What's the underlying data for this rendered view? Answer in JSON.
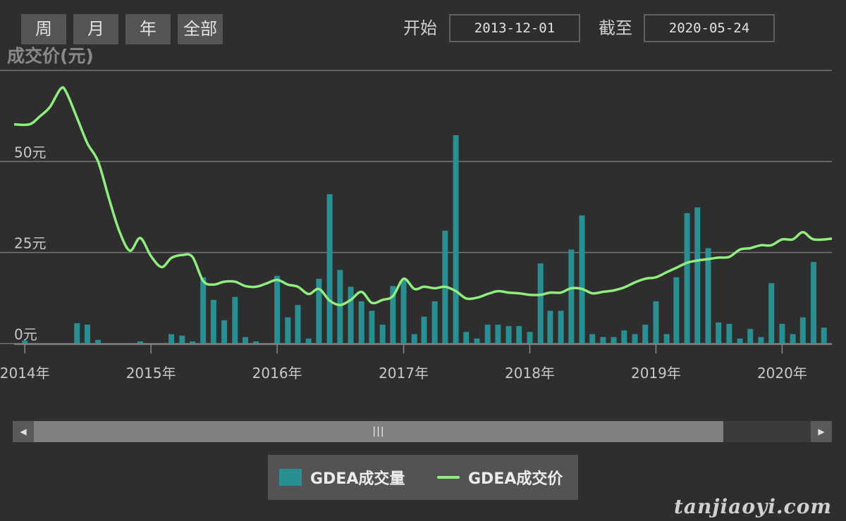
{
  "toolbar": {
    "range_buttons": [
      "周",
      "月",
      "年",
      "全部"
    ],
    "start_label": "开始",
    "start_value": "2013-12-01",
    "end_label": "截至",
    "end_value": "2020-05-24"
  },
  "legend": {
    "volume_label": "GDEA成交量",
    "price_label": "GDEA成交价"
  },
  "watermark": "tanjiaoyi.com",
  "colors": {
    "background": "#2e2e2e",
    "volume_bar": "#2a8f92",
    "price_line": "#90ee7e",
    "grid": "#777777"
  },
  "chart_data": {
    "type": "bar+line",
    "ylabel": "成交价(元)",
    "y_ticks": [
      "0元",
      "25元",
      "50元"
    ],
    "y_tick_values": [
      0,
      25,
      50
    ],
    "ylim": [
      0,
      75
    ],
    "x_range": [
      "2013-12-01",
      "2020-05-24"
    ],
    "x_tick_labels": [
      "2014年",
      "2015年",
      "2016年",
      "2017年",
      "2018年",
      "2019年",
      "2020年"
    ],
    "x_tick_dates": [
      "2014-01-01",
      "2015-01-01",
      "2016-01-01",
      "2017-01-01",
      "2018-01-01",
      "2019-01-01",
      "2020-01-01"
    ],
    "grid": true,
    "legend_position": "bottom-center",
    "series": [
      {
        "name": "GDEA成交量",
        "type": "bar",
        "points": [
          [
            "2014-01-01",
            0.8
          ],
          [
            "2014-06-01",
            5.6
          ],
          [
            "2014-07-01",
            5.2
          ],
          [
            "2014-08-01",
            1.0
          ],
          [
            "2014-12-01",
            0.6
          ],
          [
            "2015-03-01",
            2.6
          ],
          [
            "2015-04-01",
            2.2
          ],
          [
            "2015-05-01",
            0.6
          ],
          [
            "2015-06-01",
            18.2
          ],
          [
            "2015-07-01",
            12.0
          ],
          [
            "2015-08-01",
            6.4
          ],
          [
            "2015-09-01",
            12.8
          ],
          [
            "2015-10-01",
            1.8
          ],
          [
            "2015-11-01",
            0.6
          ],
          [
            "2016-01-01",
            18.6
          ],
          [
            "2016-02-01",
            7.2
          ],
          [
            "2016-03-01",
            10.6
          ],
          [
            "2016-04-01",
            1.4
          ],
          [
            "2016-05-01",
            17.8
          ],
          [
            "2016-06-01",
            41.0
          ],
          [
            "2016-07-01",
            20.2
          ],
          [
            "2016-08-01",
            15.6
          ],
          [
            "2016-09-01",
            11.6
          ],
          [
            "2016-10-01",
            9.0
          ],
          [
            "2016-11-01",
            5.2
          ],
          [
            "2016-12-01",
            15.8
          ],
          [
            "2017-01-01",
            17.6
          ],
          [
            "2017-02-01",
            2.6
          ],
          [
            "2017-03-01",
            7.4
          ],
          [
            "2017-04-01",
            11.6
          ],
          [
            "2017-05-01",
            31.0
          ],
          [
            "2017-06-01",
            57.2
          ],
          [
            "2017-07-01",
            3.2
          ],
          [
            "2017-08-01",
            1.4
          ],
          [
            "2017-09-01",
            5.2
          ],
          [
            "2017-10-01",
            5.2
          ],
          [
            "2017-11-01",
            4.8
          ],
          [
            "2017-12-01",
            4.8
          ],
          [
            "2018-01-01",
            3.2
          ],
          [
            "2018-02-01",
            22.0
          ],
          [
            "2018-03-01",
            9.0
          ],
          [
            "2018-04-01",
            9.0
          ],
          [
            "2018-05-01",
            25.8
          ],
          [
            "2018-06-01",
            35.2
          ],
          [
            "2018-07-01",
            2.6
          ],
          [
            "2018-08-01",
            1.8
          ],
          [
            "2018-09-01",
            1.8
          ],
          [
            "2018-10-01",
            3.6
          ],
          [
            "2018-11-01",
            2.6
          ],
          [
            "2018-12-01",
            5.2
          ],
          [
            "2019-01-01",
            11.6
          ],
          [
            "2019-02-01",
            2.6
          ],
          [
            "2019-03-01",
            18.2
          ],
          [
            "2019-04-01",
            35.8
          ],
          [
            "2019-05-01",
            37.4
          ],
          [
            "2019-06-01",
            26.2
          ],
          [
            "2019-07-01",
            5.8
          ],
          [
            "2019-08-01",
            5.4
          ],
          [
            "2019-09-01",
            1.4
          ],
          [
            "2019-10-01",
            4.0
          ],
          [
            "2019-11-01",
            1.8
          ],
          [
            "2019-12-01",
            16.6
          ],
          [
            "2020-01-01",
            5.4
          ],
          [
            "2020-02-01",
            2.6
          ],
          [
            "2020-03-01",
            7.2
          ],
          [
            "2020-04-01",
            22.4
          ],
          [
            "2020-05-01",
            4.4
          ]
        ]
      },
      {
        "name": "GDEA成交价",
        "type": "line",
        "points": [
          [
            "2013-12-01",
            60.2
          ],
          [
            "2014-01-15",
            60.2
          ],
          [
            "2014-02-15",
            62.5
          ],
          [
            "2014-03-15",
            65.0
          ],
          [
            "2014-04-15",
            70.0
          ],
          [
            "2014-05-01",
            69.0
          ],
          [
            "2014-06-01",
            62.0
          ],
          [
            "2014-07-01",
            55.0
          ],
          [
            "2014-08-01",
            50.0
          ],
          [
            "2014-09-01",
            40.0
          ],
          [
            "2014-10-01",
            31.0
          ],
          [
            "2014-11-01",
            25.5
          ],
          [
            "2014-12-01",
            29.0
          ],
          [
            "2015-01-01",
            24.0
          ],
          [
            "2015-02-01",
            21.0
          ],
          [
            "2015-03-01",
            23.5
          ],
          [
            "2015-04-01",
            24.3
          ],
          [
            "2015-05-01",
            23.8
          ],
          [
            "2015-06-01",
            17.2
          ],
          [
            "2015-07-01",
            16.2
          ],
          [
            "2015-08-01",
            17.0
          ],
          [
            "2015-09-01",
            17.0
          ],
          [
            "2015-10-01",
            15.8
          ],
          [
            "2015-11-01",
            15.6
          ],
          [
            "2015-12-01",
            16.5
          ],
          [
            "2016-01-01",
            17.5
          ],
          [
            "2016-02-01",
            16.2
          ],
          [
            "2016-03-01",
            15.6
          ],
          [
            "2016-04-01",
            13.6
          ],
          [
            "2016-05-01",
            15.0
          ],
          [
            "2016-06-01",
            11.8
          ],
          [
            "2016-07-01",
            10.6
          ],
          [
            "2016-08-01",
            12.0
          ],
          [
            "2016-09-01",
            14.2
          ],
          [
            "2016-10-01",
            11.2
          ],
          [
            "2016-11-01",
            12.0
          ],
          [
            "2016-12-01",
            13.0
          ],
          [
            "2017-01-01",
            17.8
          ],
          [
            "2017-02-01",
            15.0
          ],
          [
            "2017-03-01",
            15.6
          ],
          [
            "2017-04-01",
            15.2
          ],
          [
            "2017-05-01",
            15.6
          ],
          [
            "2017-06-01",
            14.4
          ],
          [
            "2017-07-01",
            12.4
          ],
          [
            "2017-08-01",
            12.6
          ],
          [
            "2017-09-01",
            13.6
          ],
          [
            "2017-10-01",
            14.4
          ],
          [
            "2017-11-01",
            14.0
          ],
          [
            "2017-12-01",
            13.8
          ],
          [
            "2018-01-01",
            13.4
          ],
          [
            "2018-02-01",
            13.4
          ],
          [
            "2018-03-01",
            14.0
          ],
          [
            "2018-04-01",
            14.0
          ],
          [
            "2018-05-01",
            15.2
          ],
          [
            "2018-06-01",
            15.0
          ],
          [
            "2018-07-01",
            13.8
          ],
          [
            "2018-08-01",
            14.2
          ],
          [
            "2018-09-01",
            14.6
          ],
          [
            "2018-10-01",
            15.4
          ],
          [
            "2018-11-01",
            16.8
          ],
          [
            "2018-12-01",
            17.8
          ],
          [
            "2019-01-01",
            18.2
          ],
          [
            "2019-02-01",
            19.6
          ],
          [
            "2019-03-01",
            20.8
          ],
          [
            "2019-04-01",
            22.2
          ],
          [
            "2019-05-01",
            22.8
          ],
          [
            "2019-06-01",
            23.2
          ],
          [
            "2019-07-01",
            23.6
          ],
          [
            "2019-08-01",
            23.8
          ],
          [
            "2019-09-01",
            25.8
          ],
          [
            "2019-10-01",
            26.2
          ],
          [
            "2019-11-01",
            27.0
          ],
          [
            "2019-12-01",
            27.0
          ],
          [
            "2020-01-01",
            28.6
          ],
          [
            "2020-02-01",
            28.6
          ],
          [
            "2020-03-01",
            30.6
          ],
          [
            "2020-04-01",
            28.6
          ],
          [
            "2020-05-24",
            28.8
          ]
        ]
      }
    ]
  }
}
